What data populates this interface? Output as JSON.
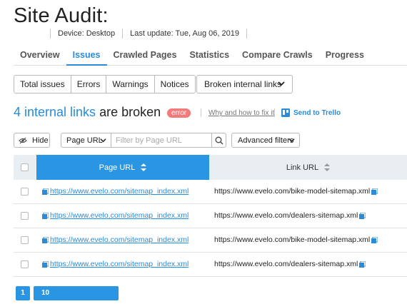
{
  "page": {
    "title": "Site Audit:"
  },
  "meta": {
    "device": "Device: Desktop",
    "last_update": "Last update: Tue, Aug 06, 2019"
  },
  "tabs": [
    {
      "label": "Overview",
      "active": false
    },
    {
      "label": "Issues",
      "active": true
    },
    {
      "label": "Crawled Pages",
      "active": false
    },
    {
      "label": "Statistics",
      "active": false
    },
    {
      "label": "Compare Crawls",
      "active": false
    },
    {
      "label": "Progress",
      "active": false
    }
  ],
  "issue_filters": [
    "Total issues",
    "Errors",
    "Warnings",
    "Notices"
  ],
  "issue_dropdown": {
    "selected": "Broken internal links",
    "icon": "chevron-down-icon"
  },
  "headline": {
    "link_text": "4 internal links",
    "rest_text": " are broken",
    "badge": "error",
    "why_link": "Why and how to fix it",
    "trello_link": "Send to Trello"
  },
  "toolbar": {
    "hide_label": "Hide",
    "field_select": "Page URL",
    "filter_placeholder": "Filter by Page URL",
    "advanced_filters": "Advanced filters"
  },
  "table": {
    "columns": [
      "Page URL",
      "Link URL"
    ],
    "sorted_column": "Page URL",
    "rows": [
      {
        "page_url": "https://www.evelo.com/sitemap_index.xml",
        "link_url": "https://www.evelo.com/bike-model-sitemap.xml"
      },
      {
        "page_url": "https://www.evelo.com/sitemap_index.xml",
        "link_url": "https://www.evelo.com/dealers-sitemap.xml"
      },
      {
        "page_url": "https://www.evelo.com/sitemap_index.xml",
        "link_url": "https://www.evelo.com/bike-model-sitemap.xml"
      },
      {
        "page_url": "https://www.evelo.com/sitemap_index.xml",
        "link_url": "https://www.evelo.com/dealers-sitemap.xml"
      }
    ]
  },
  "pagination": {
    "current_page": "1",
    "per_page": "10"
  },
  "colors": {
    "accent": "#2a95e3",
    "link": "#2a8bd8",
    "error_badge": "#f27a7a"
  }
}
